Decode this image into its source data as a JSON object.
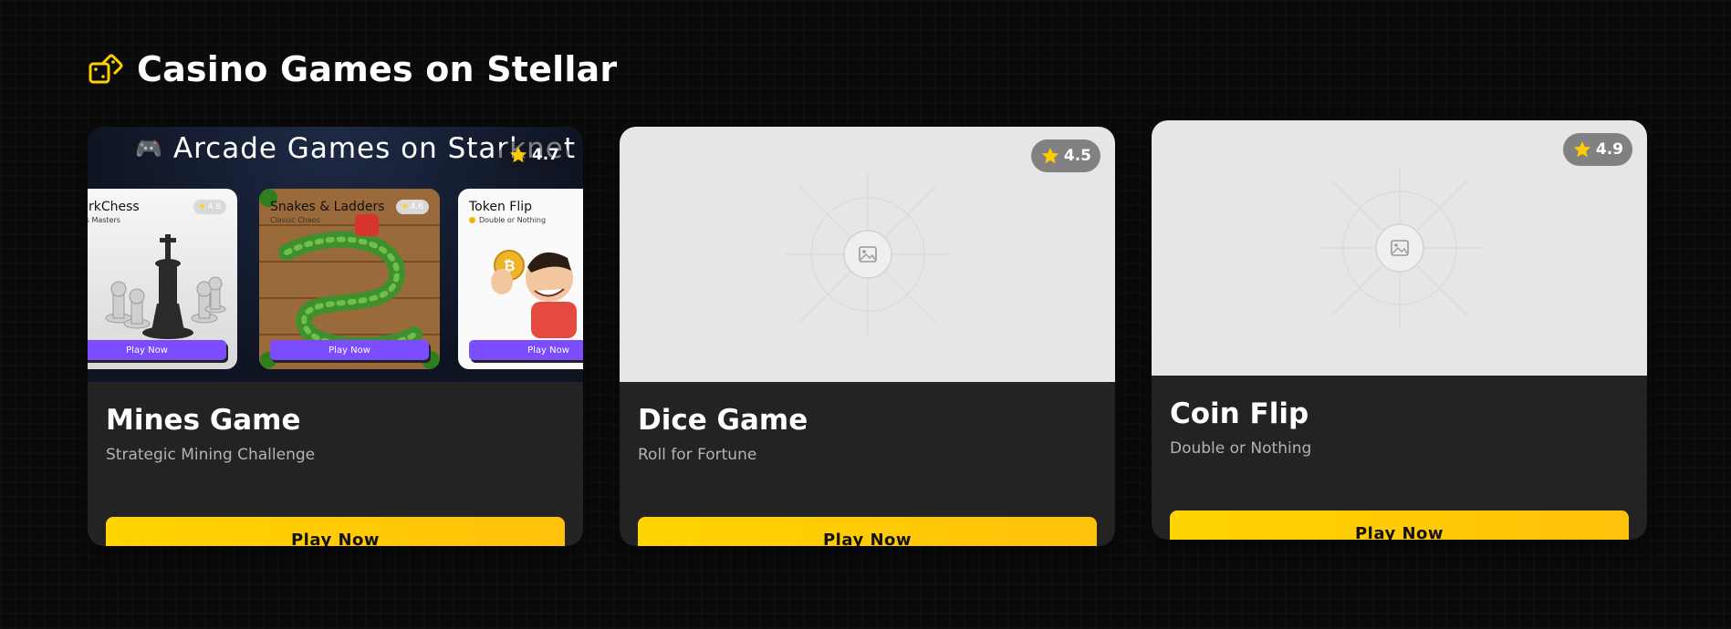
{
  "section": {
    "title": "Casino Games on Stellar",
    "icon": "dice-icon",
    "accent": "#ffd000"
  },
  "games": [
    {
      "title": "Mines Game",
      "subtitle": "Strategic Mining Challenge",
      "rating": "4.7",
      "button_label": "Play Now",
      "preview": {
        "header_title": "Arcade Games on Starknet",
        "header_icon": "gamepad-icon",
        "mini_cards": [
          {
            "title": "StarkChess",
            "subtitle": "Chess Masters",
            "rating": "4.8",
            "button_label": "Play Now",
            "art": "chess-pieces-illustration"
          },
          {
            "title": "Snakes & Ladders",
            "subtitle": "Classic Chaos",
            "rating": "4.6",
            "button_label": "Play Now",
            "art": "snake-board-illustration"
          },
          {
            "title": "Token Flip",
            "subtitle": "Double or Nothing",
            "button_label": "Play Now",
            "art": "coin-boy-illustration"
          }
        ]
      }
    },
    {
      "title": "Dice Game",
      "subtitle": "Roll for Fortune",
      "rating": "4.5",
      "button_label": "Play Now",
      "preview": {
        "art": "image-placeholder-icon"
      }
    },
    {
      "title": "Coin Flip",
      "subtitle": "Double or Nothing",
      "rating": "4.9",
      "button_label": "Play Now",
      "preview": {
        "art": "image-placeholder-icon"
      }
    }
  ],
  "colors": {
    "background": "#0a0a0a",
    "card": "#232323",
    "button_gradient_start": "#ffd400",
    "button_gradient_end": "#ffc10a",
    "star": "#ffcc00",
    "mini_button": "#7c4dff"
  }
}
